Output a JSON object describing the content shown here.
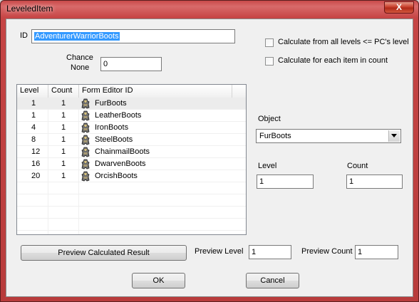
{
  "window": {
    "title": "LeveledItem",
    "close_glyph": "X"
  },
  "id_field": {
    "label": "ID",
    "value": "AdventurerWarriorBoots"
  },
  "chance_none": {
    "label_line1": "Chance",
    "label_line2": "None",
    "value": "0"
  },
  "options": {
    "calc_all_levels": "Calculate from all levels <= PC's level",
    "calc_each_item": "Calculate for each item in count"
  },
  "list": {
    "columns": [
      "Level",
      "Count",
      "Form Editor ID"
    ],
    "rows": [
      {
        "level": "1",
        "count": "1",
        "id": "FurBoots"
      },
      {
        "level": "1",
        "count": "1",
        "id": "LeatherBoots"
      },
      {
        "level": "4",
        "count": "1",
        "id": "IronBoots"
      },
      {
        "level": "8",
        "count": "1",
        "id": "SteelBoots"
      },
      {
        "level": "12",
        "count": "1",
        "id": "ChainmailBoots"
      },
      {
        "level": "16",
        "count": "1",
        "id": "DwarvenBoots"
      },
      {
        "level": "20",
        "count": "1",
        "id": "OrcishBoots"
      }
    ],
    "row_icon": "armor-piece-icon"
  },
  "object": {
    "label": "Object",
    "selected": "FurBoots"
  },
  "level": {
    "label": "Level",
    "value": "1"
  },
  "count": {
    "label": "Count",
    "value": "1"
  },
  "preview": {
    "button": "Preview Calculated Result",
    "level_label": "Preview Level",
    "level_value": "1",
    "count_label": "Preview Count",
    "count_value": "1"
  },
  "buttons": {
    "ok": "OK",
    "cancel": "Cancel"
  },
  "colors": {
    "titlebar": "#c64545",
    "close": "#c8402c",
    "selection": "#3399ff",
    "client": "#f0f0f0"
  }
}
